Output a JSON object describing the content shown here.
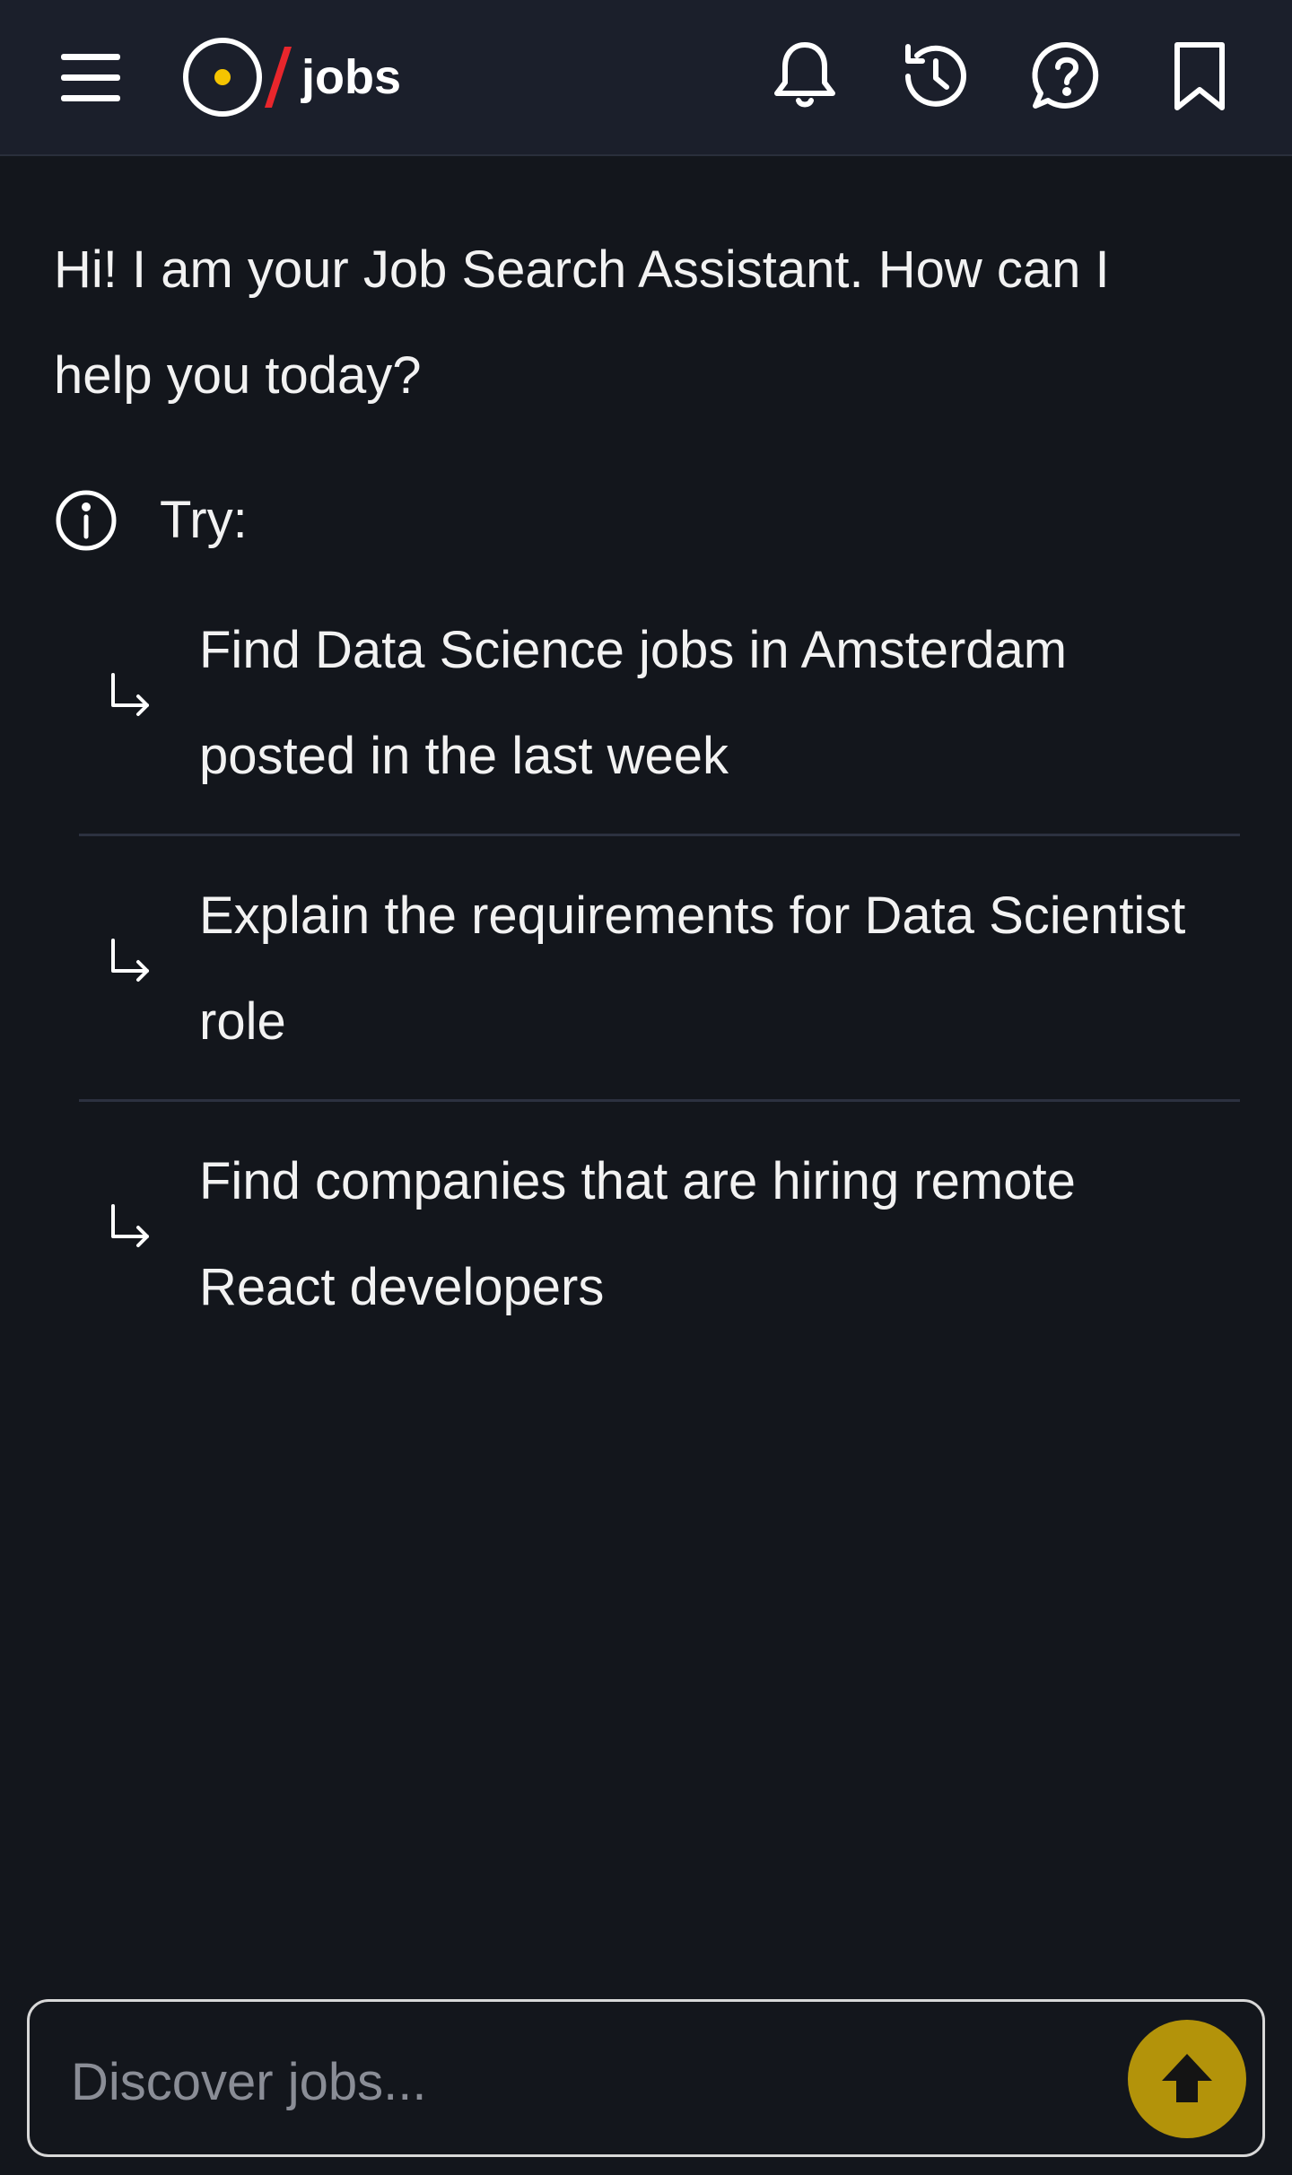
{
  "header": {
    "logo_text": "jobs",
    "brand_colors": {
      "dot": "#f5c400",
      "slash": "#e8262c"
    },
    "icons": [
      "menu-icon",
      "bell-icon",
      "history-icon",
      "help-icon",
      "bookmark-icon"
    ]
  },
  "chat": {
    "greeting": "Hi! I am your Job Search Assistant. How can I help you today?",
    "try_label": "Try:",
    "suggestions": [
      {
        "text": "Find Data Science jobs in Amsterdam posted in the last week"
      },
      {
        "text": "Explain the requirements for Data Scientist role"
      },
      {
        "text": "Find companies that are hiring remote React developers"
      }
    ]
  },
  "input": {
    "placeholder": "Discover jobs...",
    "value": "",
    "send_color": "#b3930a"
  }
}
